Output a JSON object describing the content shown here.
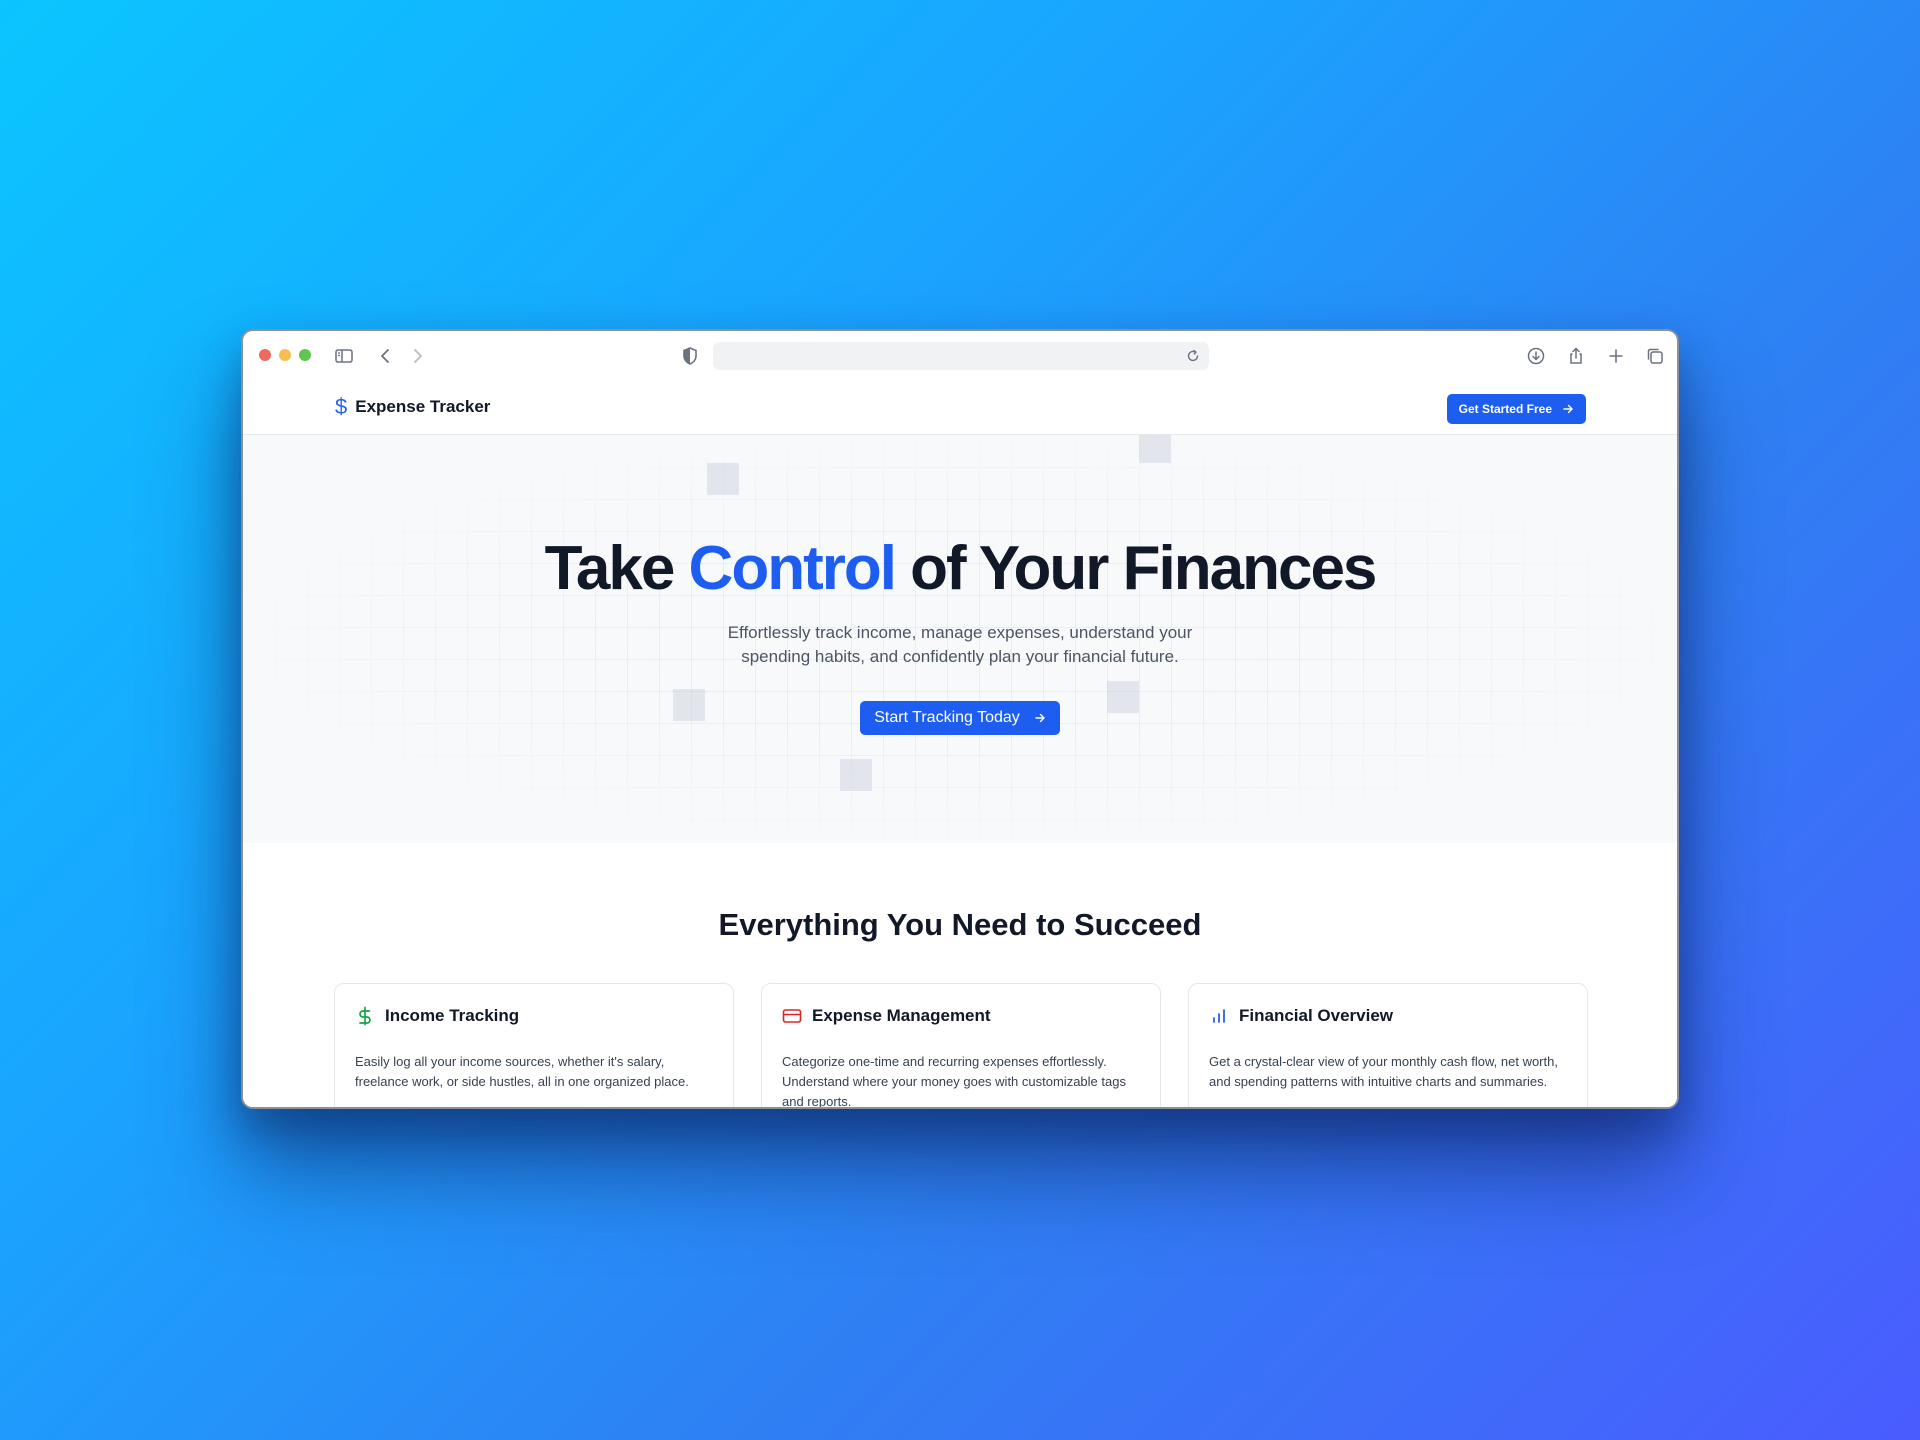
{
  "site": {
    "brand_name": "Expense Tracker",
    "brand_icon": "dollar-sign-icon",
    "header_cta": "Get Started Free"
  },
  "hero": {
    "title_part1": "Take ",
    "title_accent": "Control",
    "title_part2": " of Your Finances",
    "subtitle": "Effortlessly track income, manage expenses, understand your spending habits, and confidently plan your financial future.",
    "cta": "Start Tracking Today"
  },
  "features": {
    "heading": "Everything You Need to Succeed",
    "cards": [
      {
        "title": "Income Tracking",
        "icon": "dollar-sign-icon",
        "icon_color": "#16a34a",
        "description": "Easily log all your income sources, whether it's salary, freelance work, or side hustles, all in one organized place."
      },
      {
        "title": "Expense Management",
        "icon": "credit-card-icon",
        "icon_color": "#dc2626",
        "description": "Categorize one-time and recurring expenses effortlessly. Understand where your money goes with customizable tags and reports."
      },
      {
        "title": "Financial Overview",
        "icon": "bar-chart-icon",
        "icon_color": "#2563eb",
        "description": "Get a crystal-clear view of your monthly cash flow, net worth, and spending patterns with intuitive charts and summaries."
      }
    ]
  },
  "colors": {
    "primary": "#1d5ef0",
    "text_dark": "#111827",
    "text_muted": "#4b5563"
  }
}
